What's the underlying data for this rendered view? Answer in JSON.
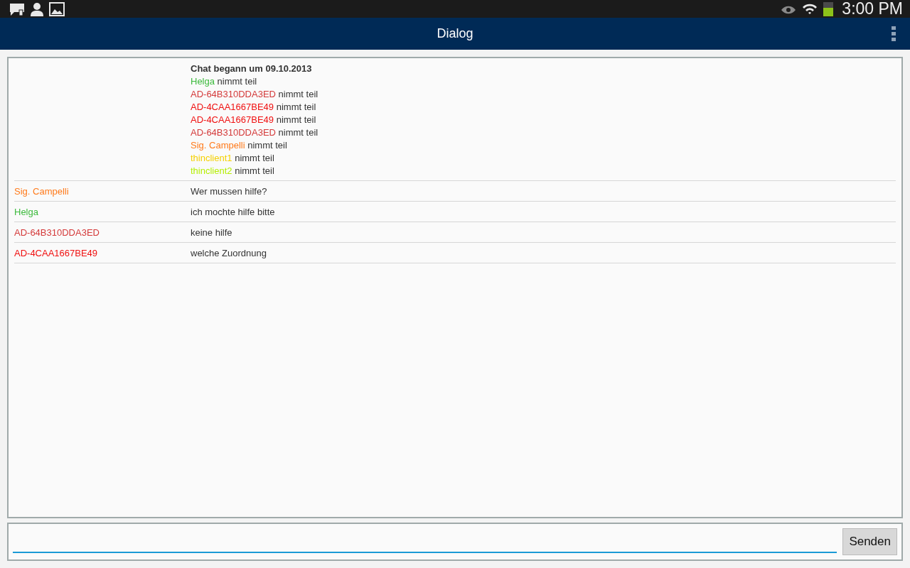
{
  "status_bar": {
    "time": "3:00 PM"
  },
  "action_bar": {
    "title": "Dialog"
  },
  "chat": {
    "header": "Chat begann um 09.10.2013",
    "joins": [
      {
        "name": "Helga",
        "color": "#3cba3c",
        "text": "nimmt teil"
      },
      {
        "name": "AD-64B310DDA3ED",
        "color": "#d43a3a",
        "text": "nimmt teil"
      },
      {
        "name": "AD-4CAA1667BE49",
        "color": "#f01010",
        "text": "nimmt teil"
      },
      {
        "name": "AD-4CAA1667BE49",
        "color": "#f01010",
        "text": "nimmt teil"
      },
      {
        "name": "AD-64B310DDA3ED",
        "color": "#d43a3a",
        "text": "nimmt teil"
      },
      {
        "name": "Sig. Campelli",
        "color": "#ff7a1a",
        "text": "nimmt teil"
      },
      {
        "name": "thinclient1",
        "color": "#f5d000",
        "text": "nimmt teil"
      },
      {
        "name": "thinclient2",
        "color": "#b4ee00",
        "text": "nimmt teil"
      }
    ],
    "messages": [
      {
        "sender": "Sig. Campelli",
        "color": "#ff7a1a",
        "text": "Wer mussen hilfe?"
      },
      {
        "sender": "Helga",
        "color": "#3cba3c",
        "text": "ich mochte hilfe bitte"
      },
      {
        "sender": "AD-64B310DDA3ED",
        "color": "#d43a3a",
        "text": "keine hilfe"
      },
      {
        "sender": "AD-4CAA1667BE49",
        "color": "#f01010",
        "text": "welche Zuordnung"
      }
    ]
  },
  "composer": {
    "send_button": "Senden"
  }
}
